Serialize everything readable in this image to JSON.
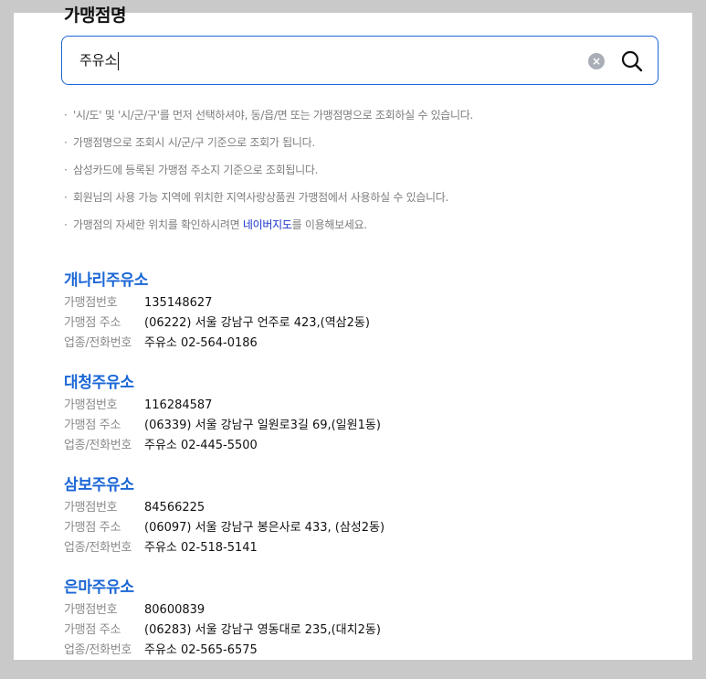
{
  "page": {
    "title": "가맹점명"
  },
  "search": {
    "value": "주유소",
    "clear_label": "×",
    "search_icon": "search-icon",
    "clear_icon": "clear-icon",
    "accent_color": "#1a66d6"
  },
  "notices": [
    {
      "text": "'시/도' 및 '시/군/구'를 먼저 선택하셔야, 동/읍/면 또는 가맹점명으로 조회하실 수 있습니다."
    },
    {
      "text": "가맹점명으로 조회시 시/군/구 기준으로 조회가 됩니다."
    },
    {
      "text": "삼성카드에 등록된 가맹점 주소지 기준으로 조회됩니다."
    },
    {
      "text": "회원님의 사용 가능 지역에 위치한 지역사랑상품권 가맹점에서 사용하실 수 있습니다."
    },
    {
      "text_before": "가맹점의 자세한 위치를 확인하시려면 ",
      "link": "네이버지도",
      "text_after": "를 이용해보세요."
    }
  ],
  "labels": {
    "merchant_no": "가맹점번호",
    "address": "가맹점 주소",
    "category_phone": "업종/전화번호"
  },
  "merchants": [
    {
      "name": "개나리주유소",
      "merchant_no": "135148627",
      "address": "(06222) 서울 강남구 언주로 423,(역삼2동)",
      "category_phone": "주유소 02-564-0186"
    },
    {
      "name": "대청주유소",
      "merchant_no": "116284587",
      "address": "(06339) 서울 강남구 일원로3길 69,(일원1동)",
      "category_phone": "주유소 02-445-5500"
    },
    {
      "name": "삼보주유소",
      "merchant_no": "84566225",
      "address": "(06097) 서울 강남구 봉은사로 433, (삼성2동)",
      "category_phone": "주유소 02-518-5141"
    },
    {
      "name": "은마주유소",
      "merchant_no": "80600839",
      "address": "(06283) 서울 강남구 영동대로 235,(대치2동)",
      "category_phone": "주유소 02-565-6575"
    }
  ]
}
